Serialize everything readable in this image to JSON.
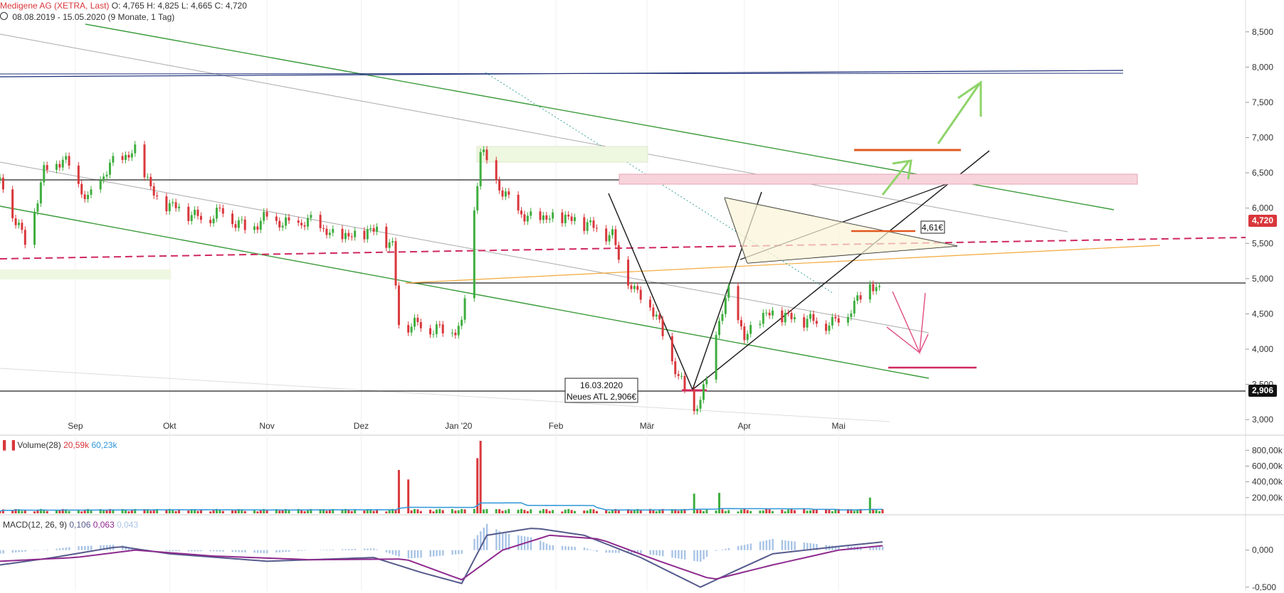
{
  "header": {
    "title": "Medigene AG (XETRA, Last)",
    "ohlc": "O: 4,765  H: 4,825  L: 4,665  C: 4,720",
    "range": "08.08.2019 - 15.05.2020",
    "range_detail": "(9 Monate, 1 Tag)"
  },
  "colors": {
    "up": "#3fae3f",
    "down": "#d9373b",
    "vol_ma": "#2f96d9",
    "macd": "#555a8c",
    "signal": "#8e2a8e",
    "hist": "#a8c4e6"
  },
  "chart_data": [
    {
      "type": "candlestick",
      "title": "Medigene AG (XETRA, Last)",
      "ylim": [
        2.8,
        8.8
      ],
      "yticks": [
        "3,000",
        "3,500",
        "4,000",
        "4,500",
        "5,000",
        "5,500",
        "6,000",
        "6,500",
        "7,000",
        "7,500",
        "8,000",
        "8,500"
      ],
      "ytick_values": [
        3.0,
        3.5,
        4.0,
        4.5,
        5.0,
        5.5,
        6.0,
        6.5,
        7.0,
        7.5,
        8.0,
        8.5
      ],
      "xticks": [
        "Sep",
        "Okt",
        "Nov",
        "Dez",
        "Jan '20",
        "Feb",
        "Mär",
        "Apr",
        "Mai"
      ],
      "last_price": "4,720",
      "low_marker": "2,906",
      "annotations": {
        "date": "16.03.2020",
        "atl": "Neues ATL 2,906€",
        "target": "4,61€"
      },
      "price_path": [
        [
          "2019-08-08",
          6.4
        ],
        [
          "2019-08-16",
          5.5
        ],
        [
          "2019-08-22",
          6.5
        ],
        [
          "2019-08-28",
          6.7
        ],
        [
          "2019-09-05",
          6.1
        ],
        [
          "2019-09-12",
          6.6
        ],
        [
          "2019-09-20",
          6.8
        ],
        [
          "2019-09-27",
          6.1
        ],
        [
          "2019-10-04",
          6.0
        ],
        [
          "2019-10-11",
          5.85
        ],
        [
          "2019-10-18",
          5.95
        ],
        [
          "2019-10-25",
          5.7
        ],
        [
          "2019-11-01",
          5.85
        ],
        [
          "2019-11-08",
          5.75
        ],
        [
          "2019-11-15",
          5.8
        ],
        [
          "2019-11-22",
          5.6
        ],
        [
          "2019-11-29",
          5.6
        ],
        [
          "2019-12-06",
          5.7
        ],
        [
          "2019-12-11",
          5.45
        ],
        [
          "2019-12-13",
          4.35
        ],
        [
          "2019-12-18",
          4.35
        ],
        [
          "2019-12-27",
          4.25
        ],
        [
          "2020-01-02",
          4.3
        ],
        [
          "2020-01-08",
          6.8
        ],
        [
          "2020-01-15",
          6.2
        ],
        [
          "2020-01-22",
          5.85
        ],
        [
          "2020-01-29",
          5.85
        ],
        [
          "2020-02-05",
          5.85
        ],
        [
          "2020-02-12",
          5.75
        ],
        [
          "2020-02-19",
          5.6
        ],
        [
          "2020-02-21",
          5.3
        ],
        [
          "2020-02-26",
          4.8
        ],
        [
          "2020-03-02",
          4.65
        ],
        [
          "2020-03-06",
          4.2
        ],
        [
          "2020-03-11",
          3.6
        ],
        [
          "2020-03-16",
          3.1
        ],
        [
          "2020-03-20",
          3.5
        ],
        [
          "2020-03-24",
          4.4
        ],
        [
          "2020-03-27",
          4.8
        ],
        [
          "2020-04-01",
          4.15
        ],
        [
          "2020-04-08",
          4.5
        ],
        [
          "2020-04-15",
          4.45
        ],
        [
          "2020-04-22",
          4.4
        ],
        [
          "2020-04-29",
          4.35
        ],
        [
          "2020-05-06",
          4.6
        ],
        [
          "2020-05-11",
          4.95
        ],
        [
          "2020-05-15",
          4.72
        ]
      ]
    },
    {
      "type": "bar",
      "title": "Volume(28)",
      "values_label": [
        "20,59k",
        "60,23k"
      ],
      "yticks": [
        "200,00k",
        "400,00k",
        "600,00k",
        "800,00k"
      ],
      "ytick_values": [
        200,
        400,
        600,
        800
      ],
      "ylim": [
        0,
        920
      ],
      "volume_points": [
        [
          "2019-12-13",
          550
        ],
        [
          "2019-12-16",
          430
        ],
        [
          "2020-01-08",
          920
        ],
        [
          "2020-01-07",
          700
        ],
        [
          "2020-03-16",
          250
        ],
        [
          "2020-03-24",
          260
        ],
        [
          "2020-05-11",
          200
        ]
      ],
      "base_volume": 40
    },
    {
      "type": "line",
      "title": "MACD(12, 26, 9)",
      "values_label": [
        "0,106",
        "0,063",
        "0,043"
      ],
      "yticks": [
        "-0,500",
        "0,000"
      ],
      "ytick_values": [
        -0.5,
        0.0
      ],
      "ylim": [
        -0.55,
        0.4
      ],
      "macd_path": [
        [
          "2019-08-08",
          -0.2
        ],
        [
          "2019-08-25",
          -0.1
        ],
        [
          "2019-09-15",
          0.05
        ],
        [
          "2019-10-01",
          -0.05
        ],
        [
          "2019-11-01",
          -0.15
        ],
        [
          "2019-12-05",
          -0.1
        ],
        [
          "2019-12-20",
          -0.3
        ],
        [
          "2020-01-02",
          -0.45
        ],
        [
          "2020-01-10",
          0.2
        ],
        [
          "2020-01-25",
          0.3
        ],
        [
          "2020-02-10",
          0.2
        ],
        [
          "2020-02-28",
          -0.1
        ],
        [
          "2020-03-18",
          -0.5
        ],
        [
          "2020-03-28",
          -0.3
        ],
        [
          "2020-04-10",
          -0.05
        ],
        [
          "2020-05-01",
          0.05
        ],
        [
          "2020-05-15",
          0.11
        ]
      ],
      "signal_path": [
        [
          "2019-08-08",
          -0.15
        ],
        [
          "2019-09-01",
          -0.1
        ],
        [
          "2019-09-20",
          0.0
        ],
        [
          "2019-10-15",
          -0.08
        ],
        [
          "2019-11-15",
          -0.13
        ],
        [
          "2019-12-15",
          -0.12
        ],
        [
          "2020-01-02",
          -0.4
        ],
        [
          "2020-01-15",
          0.0
        ],
        [
          "2020-01-30",
          0.2
        ],
        [
          "2020-02-15",
          0.15
        ],
        [
          "2020-03-05",
          -0.15
        ],
        [
          "2020-03-22",
          -0.4
        ],
        [
          "2020-04-10",
          -0.2
        ],
        [
          "2020-05-01",
          0.0
        ],
        [
          "2020-05-15",
          0.06
        ]
      ]
    }
  ]
}
